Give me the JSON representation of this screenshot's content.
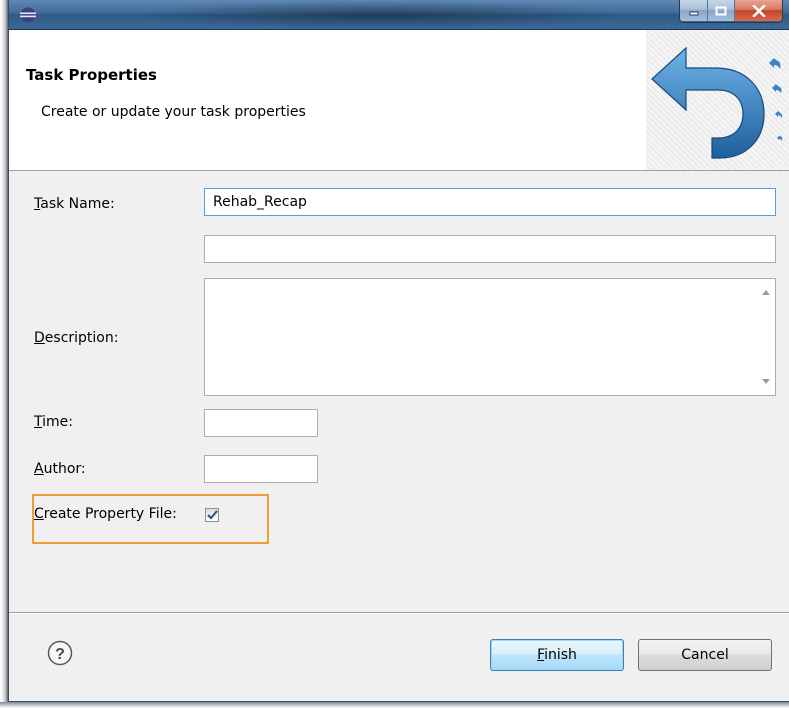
{
  "header": {
    "title": "Task Properties",
    "subtitle": "Create or update your task properties"
  },
  "form": {
    "task_name_label": "Task Name:",
    "task_name_value": "Rehab_Recap",
    "secondary_value": "",
    "description_label": "Description:",
    "description_value": "",
    "time_label": "Time:",
    "time_value": "",
    "author_label": "Author:",
    "author_value": "",
    "create_property_file_label": "Create Property File:",
    "create_property_file_checked": true
  },
  "footer": {
    "finish_label": "Finish",
    "cancel_label": "Cancel"
  },
  "icons": {
    "app": "eclipse-icon",
    "minimize": "minimize-icon",
    "maximize": "maximize-icon",
    "close": "close-icon",
    "banner": "undo-arrow-icon",
    "help": "help-icon"
  },
  "colors": {
    "highlight": "#f39b35",
    "banner_arrow": "#2f76b4"
  }
}
